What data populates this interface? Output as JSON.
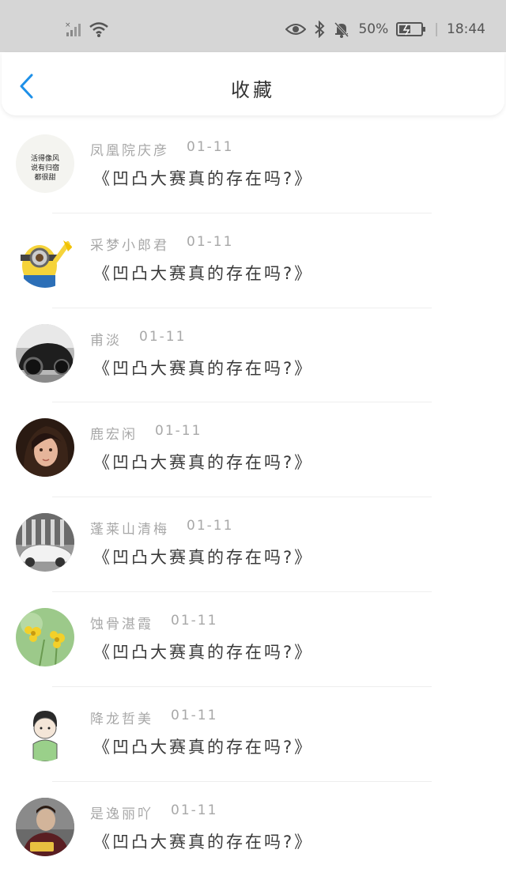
{
  "status_bar": {
    "battery": "50%",
    "time": "18:44"
  },
  "header": {
    "title": "收藏"
  },
  "items": [
    {
      "user": "凤凰院庆彦",
      "date": "01-11",
      "text": "《凹凸大赛真的存在吗?》",
      "avatar_text": "活得像风 说有归宿 都很甜",
      "avatar_type": "handwriting"
    },
    {
      "user": "采梦小郎君",
      "date": "01-11",
      "text": "《凹凸大赛真的存在吗?》",
      "avatar_type": "minion"
    },
    {
      "user": "甫淡",
      "date": "01-11",
      "text": "《凹凸大赛真的存在吗?》",
      "avatar_type": "car-dark"
    },
    {
      "user": "鹿宏闲",
      "date": "01-11",
      "text": "《凹凸大赛真的存在吗?》",
      "avatar_type": "portrait"
    },
    {
      "user": "蓬莱山清梅",
      "date": "01-11",
      "text": "《凹凸大赛真的存在吗?》",
      "avatar_type": "car-white"
    },
    {
      "user": "蚀骨湛霞",
      "date": "01-11",
      "text": "《凹凸大赛真的存在吗?》",
      "avatar_type": "flowers"
    },
    {
      "user": "降龙哲美",
      "date": "01-11",
      "text": "《凹凸大赛真的存在吗?》",
      "avatar_type": "cartoon-boy"
    },
    {
      "user": "是逸丽吖",
      "date": "01-11",
      "text": "《凹凸大赛真的存在吗?》",
      "avatar_type": "person"
    }
  ]
}
